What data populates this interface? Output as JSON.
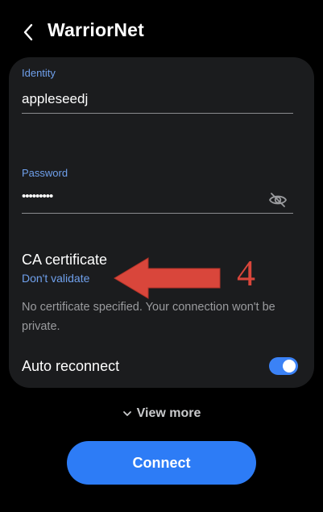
{
  "header": {
    "back_icon": "chevron-left-icon",
    "title": "WarriorNet"
  },
  "identity": {
    "label": "Identity",
    "value": "appleseedj"
  },
  "password": {
    "label": "Password",
    "value": "•••••••••",
    "visibility_icon": "eye-off-icon"
  },
  "ca_certificate": {
    "title": "CA certificate",
    "selected": "Don't validate",
    "note": "No certificate specified. Your connection won't be private."
  },
  "auto_reconnect": {
    "label": "Auto reconnect",
    "enabled": true
  },
  "annotation": {
    "number": "4",
    "color": "#d9463b"
  },
  "view_more": {
    "label": "View more",
    "icon": "chevron-down-icon"
  },
  "connect_button": {
    "label": "Connect",
    "color": "#2d7cf6"
  },
  "colors": {
    "accent_text": "#6fa0ec",
    "card_bg": "#1b1c1e",
    "toggle_on": "#3b82f6"
  }
}
